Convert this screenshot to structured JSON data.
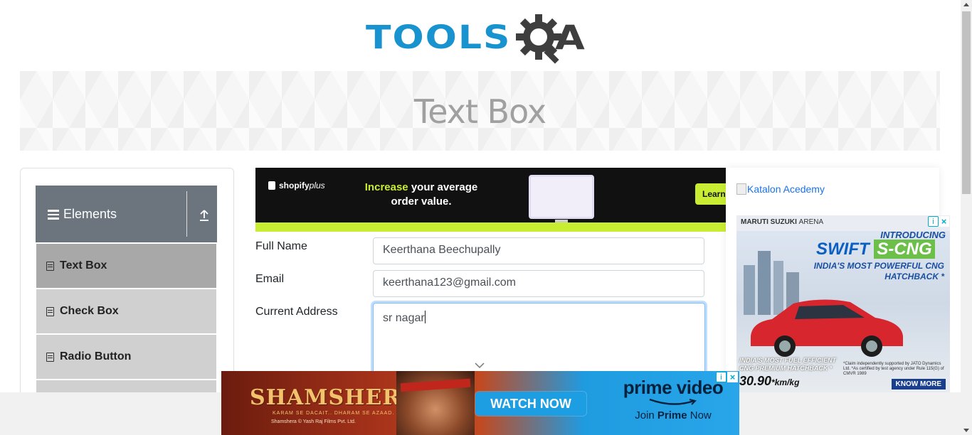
{
  "logo": {
    "word": "TOOLS",
    "a": "A"
  },
  "banner": {
    "title": "Text Box"
  },
  "sidebar": {
    "group_title": "Elements",
    "items": [
      {
        "label": "Text Box",
        "active": true
      },
      {
        "label": "Check Box",
        "active": false
      },
      {
        "label": "Radio Button",
        "active": false
      }
    ]
  },
  "top_ad": {
    "brand": "shopify",
    "brand_suffix": "plus",
    "headline_highlight": "Increase",
    "headline_rest": " your average order value.",
    "button": "Learn"
  },
  "form": {
    "full_name_label": "Full Name",
    "full_name_value": "Keerthana Beechupally",
    "email_label": "Email",
    "email_value": "keerthana123@gmail.com",
    "address_label": "Current Address",
    "address_value": "sr nagar"
  },
  "right": {
    "katalon_alt": "Katalon Acedemy"
  },
  "suzuki_ad": {
    "brand": "MARUTI SUZUKI",
    "arena": "ARENA",
    "introducing": "INTRODUCING",
    "model": "SWIFT",
    "variant": "S-CNG",
    "tagline": "INDIA'S MOST POWERFUL CNG HATCHBACK *",
    "fuel_line1": "INDIA'S MOST FUEL EFFICIENT",
    "fuel_line2": "CNG PREMIUM HATCHBACK *",
    "price": "30.90",
    "price_unit": "*km/kg",
    "claim": "*Claim independently supported by JATO Dynamics Ltd. *As certified by test agency under Rule 115(G) of CMVR 1989",
    "cta": "KNOW MORE"
  },
  "bottom_ad": {
    "movie": "SHAMSHERA",
    "subtitle": "KARAM SE DACAIT.. DHARAM SE AZAAD.",
    "credit": "Shamshera © Yash Raj Films Pvt. Ltd.",
    "cta": "WATCH NOW",
    "service": "prime video",
    "join_pre": "Join ",
    "join_bold": "Prime",
    "join_post": " Now"
  },
  "colors": {
    "logo_blue": "#1993cf",
    "sidebar_header": "#6c757d",
    "active_item": "#a8a8a8",
    "item_bg": "#d0d0d0"
  }
}
